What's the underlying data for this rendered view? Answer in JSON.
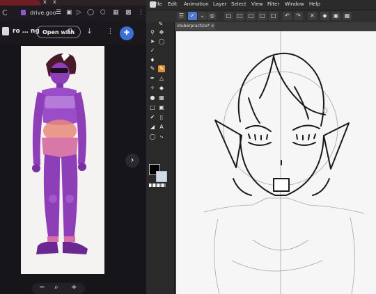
{
  "browser": {
    "tab_close": "x",
    "reload_glyph": "C",
    "url_domain": "drive.goo",
    "file_name_start": "ro",
    "file_name_end": "ng",
    "open_with_label": "Open with",
    "next_glyph": "›",
    "zoom_minus": "−",
    "zoom_plus": "+",
    "zoom_glyph": "⌕",
    "icons": [
      "reload-icon",
      "lock-icon",
      "tune-icon",
      "camera-icon",
      "send-icon",
      "check-icon",
      "box-icon",
      "qr-icon",
      "grid-icon",
      "dots-icon",
      "file-icon",
      "print-icon",
      "download-icon",
      "more-icon",
      "share-icon",
      "next-icon",
      "zoom-out-icon",
      "zoom-icon",
      "zoom-in-icon"
    ]
  },
  "image_colors": {
    "skin": "#8e3fb8",
    "skin_light": "#b67bd8",
    "hair": "#4a1a2a",
    "belly": "#e88a7a",
    "paper": "#f5f3f2"
  },
  "clip_studio": {
    "menu": [
      "File",
      "Edit",
      "Animation",
      "Layer",
      "Select",
      "View",
      "Filter",
      "Window",
      "Help"
    ],
    "doc_tab_label": "vtuberpractice*",
    "doc_tab_close": "x",
    "accent_color": "#4c7bd1",
    "selected_tool_color": "#e09030",
    "main_color": "#000000",
    "sub_color": "#cfdbe8",
    "tool_icons": [
      "pen-tool-icon",
      "zoom-tool-icon",
      "move-tool-icon",
      "operation-tool-icon",
      "lasso-tool-icon",
      "eyedropper-tool-icon",
      "pen-icon",
      "pencil-icon",
      "brush-icon",
      "airbrush-icon",
      "decoration-icon",
      "eraser-icon",
      "blend-icon",
      "fill-icon",
      "gradient-icon",
      "figure-icon",
      "frame-icon",
      "ruler-icon",
      "text-icon",
      "balloon-icon",
      "correction-icon",
      "vector-icon"
    ]
  }
}
